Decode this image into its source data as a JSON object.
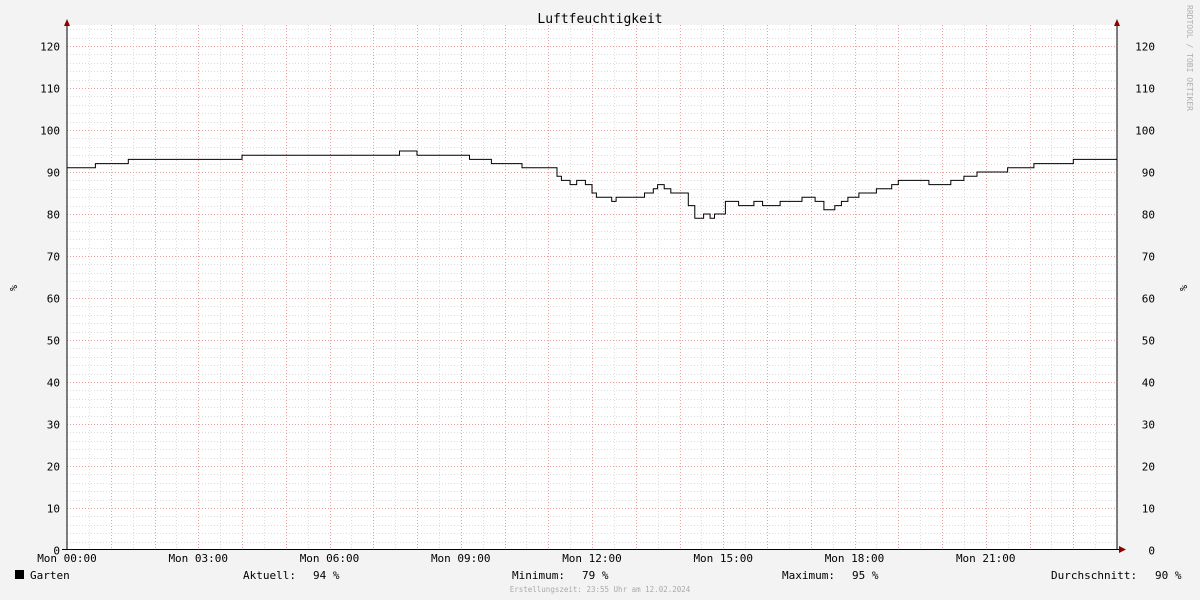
{
  "chart_data": {
    "type": "line",
    "title": "Luftfeuchtigkeit",
    "ylabel": "%",
    "watermark": "RRDTOOL / TOBI OETIKER",
    "ylim": [
      0,
      125
    ],
    "yticks": [
      0,
      10,
      20,
      30,
      40,
      50,
      60,
      70,
      80,
      90,
      100,
      110,
      120
    ],
    "xlim": [
      0,
      24
    ],
    "xticks": [
      {
        "hour": 0,
        "label": "Mon 00:00"
      },
      {
        "hour": 3,
        "label": "Mon 03:00"
      },
      {
        "hour": 6,
        "label": "Mon 06:00"
      },
      {
        "hour": 9,
        "label": "Mon 09:00"
      },
      {
        "hour": 12,
        "label": "Mon 12:00"
      },
      {
        "hour": 15,
        "label": "Mon 15:00"
      },
      {
        "hour": 18,
        "label": "Mon 18:00"
      },
      {
        "hour": 21,
        "label": "Mon 21:00"
      }
    ],
    "grid": true,
    "legend_position": "bottom",
    "series": [
      {
        "name": "Garten",
        "color": "#000000",
        "unit": "%",
        "x": [
          0,
          0.65,
          1.4,
          4.0,
          7.6,
          8.0,
          9.2,
          9.7,
          10.4,
          11.2,
          11.3,
          11.5,
          11.65,
          11.85,
          12.0,
          12.1,
          12.45,
          12.55,
          12.7,
          13.2,
          13.4,
          13.5,
          13.65,
          13.8,
          14.2,
          14.35,
          14.55,
          14.7,
          14.8,
          15.05,
          15.35,
          15.7,
          15.9,
          16.3,
          16.8,
          17.1,
          17.3,
          17.55,
          17.7,
          17.85,
          18.1,
          18.5,
          18.85,
          19.0,
          19.7,
          20.2,
          20.5,
          20.8,
          21.5,
          22.1,
          23.0,
          24.0
        ],
        "y": [
          91,
          92,
          93,
          94,
          95,
          94,
          93,
          92,
          91,
          89,
          88,
          87,
          88,
          87,
          85,
          84,
          83,
          84,
          84,
          85,
          86,
          87,
          86,
          85,
          82,
          79,
          80,
          79,
          80,
          83,
          82,
          83,
          82,
          83,
          84,
          83,
          81,
          82,
          83,
          84,
          85,
          86,
          87,
          88,
          87,
          88,
          89,
          90,
          91,
          92,
          93,
          94
        ]
      }
    ],
    "stats": {
      "current_label": "Aktuell:",
      "current": "94 %",
      "min_label": "Minimum:",
      "min": "79 %",
      "max_label": "Maximum:",
      "max": "95 %",
      "avg_label": "Durchschnitt:",
      "avg": "90 %"
    },
    "footer": "Erstellungszeit: 23:55 Uhr am 12.02.2024"
  }
}
